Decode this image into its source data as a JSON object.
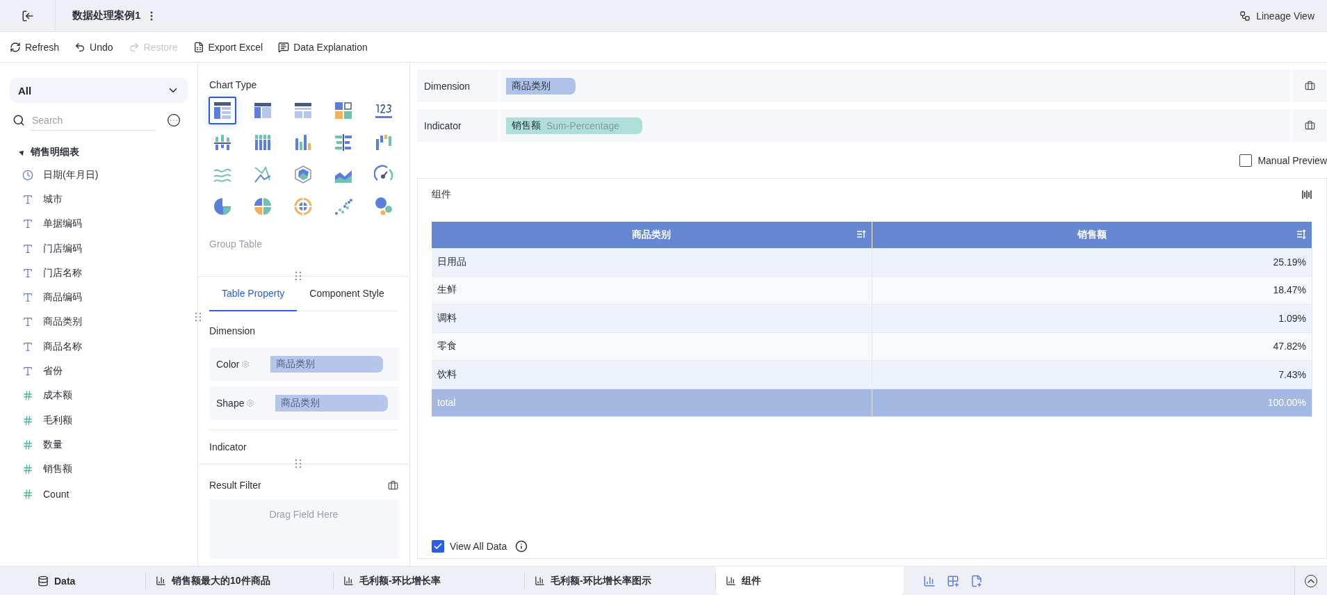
{
  "header": {
    "title": "数据处理案例1",
    "lineage": "Lineage View"
  },
  "toolbar": [
    {
      "label": "Refresh",
      "kind": "refresh",
      "disabled": false
    },
    {
      "label": "Undo",
      "kind": "undo",
      "disabled": false
    },
    {
      "label": "Restore",
      "kind": "redo",
      "disabled": true
    },
    {
      "label": "Export Excel",
      "kind": "excel",
      "disabled": false
    },
    {
      "label": "Data Explanation",
      "kind": "explain",
      "disabled": false
    }
  ],
  "fields_panel": {
    "scope": "All",
    "search_placeholder": "Search",
    "table": {
      "name": "销售明细表",
      "expanded": true,
      "children": [
        {
          "name": "日期(年月日)",
          "kind": "date"
        },
        {
          "name": "城市",
          "kind": "text"
        },
        {
          "name": "单据编码",
          "kind": "text"
        },
        {
          "name": "门店编码",
          "kind": "text"
        },
        {
          "name": "门店名称",
          "kind": "text"
        },
        {
          "name": "商品编码",
          "kind": "text"
        },
        {
          "name": "商品类别",
          "kind": "text"
        },
        {
          "name": "商品名称",
          "kind": "text"
        },
        {
          "name": "省份",
          "kind": "text"
        },
        {
          "name": "成本额",
          "kind": "number"
        },
        {
          "name": "毛利额",
          "kind": "number"
        },
        {
          "name": "数量",
          "kind": "number"
        },
        {
          "name": "销售额",
          "kind": "number"
        },
        {
          "name": "Count",
          "kind": "count"
        }
      ]
    }
  },
  "chart_panel": {
    "title": "Chart Type",
    "chart_types": [
      {
        "selected": true
      },
      {
        "selected": false
      },
      {
        "selected": false
      },
      {
        "selected": false
      },
      {
        "selected": false
      },
      {
        "selected": false
      },
      {
        "selected": false
      },
      {
        "selected": false
      },
      {
        "selected": false
      },
      {
        "selected": false
      },
      {
        "selected": false
      },
      {
        "selected": false
      },
      {
        "selected": false
      },
      {
        "selected": false
      },
      {
        "selected": false
      },
      {
        "selected": false
      },
      {
        "selected": false
      },
      {
        "selected": false
      },
      {
        "selected": false
      },
      {
        "selected": false
      }
    ],
    "chart_name": "Group Table",
    "tabs": [
      {
        "label": "Table Property",
        "selected": true
      },
      {
        "label": "Component Style",
        "selected": false
      }
    ],
    "dimension_title": "Dimension",
    "properties": [
      {
        "label": "Color",
        "field": "商品类别"
      },
      {
        "label": "Shape",
        "field": "商品类别"
      }
    ],
    "indicator_title": "Indicator",
    "result_filter": {
      "title": "Result Filter",
      "placeholder": "Drag Field Here"
    }
  },
  "shelves": [
    {
      "label": "Dimension",
      "kind": "dimension",
      "field": "商品类别"
    },
    {
      "label": "Indicator",
      "kind": "indicator",
      "field": "销售额",
      "aggregation": "Sum-Percentage"
    }
  ],
  "manual_preview": {
    "label": "Manual Preview",
    "checked": false
  },
  "component": {
    "title": "组件",
    "table": {
      "columns": [
        "商品类别",
        "销售额"
      ],
      "rows": [
        [
          "日用品",
          "25.19%"
        ],
        [
          "生鲜",
          "18.47%"
        ],
        [
          "调料",
          "1.09%"
        ],
        [
          "零食",
          "47.82%"
        ],
        [
          "饮料",
          "7.43%"
        ]
      ],
      "total": [
        "total",
        "100.00%"
      ]
    },
    "view_all": {
      "label": "View All Data",
      "checked": true
    }
  },
  "bottom_tabs": [
    {
      "label": "Data",
      "kind": "data",
      "selected": false
    },
    {
      "label": "销售额最大的10件商品",
      "kind": "sheet",
      "selected": false
    },
    {
      "label": "毛利额-环比增长率",
      "kind": "sheet",
      "selected": false
    },
    {
      "label": "毛利额-环比增长率图示",
      "kind": "sheet",
      "selected": false
    },
    {
      "label": "组件",
      "kind": "sheet",
      "selected": true
    }
  ]
}
